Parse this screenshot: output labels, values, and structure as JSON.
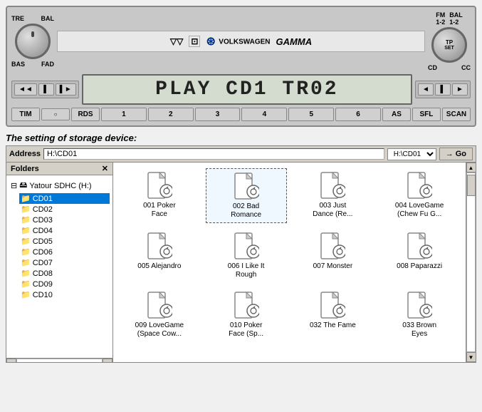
{
  "radio": {
    "knob_left": {
      "top_left": "TRE",
      "top_right": "BAL",
      "bot_left": "BAS",
      "bot_right": "FAD"
    },
    "brand": {
      "logo": "VW",
      "name": "VOLKSWAGEN",
      "model": "GAMMA"
    },
    "transport": {
      "rewind": "◄◄",
      "play_pause": "▌▌",
      "forward": "▌►"
    },
    "display": {
      "text": "PLAY CD1 TR02"
    },
    "fm_badge": "FM\n1-2",
    "bal_badge": "BAL\n1-2",
    "tp_label": "TP",
    "set_label": "SET",
    "cd_label": "CD",
    "cc_label": "CC",
    "nav_left": [
      "◄",
      "▌",
      "►"
    ],
    "nav_right_left": "◄",
    "nav_right_mid": "▌",
    "nav_right_right": "►",
    "presets": {
      "tim": "TIM",
      "dot": "○",
      "rds": "RDS",
      "nums": [
        "1",
        "2",
        "3",
        "4",
        "5",
        "6"
      ],
      "as": "AS",
      "sfl": "SFL",
      "scan": "SCAN"
    }
  },
  "diagram": {
    "label": "The setting of storage device:"
  },
  "browser": {
    "address_label": "Address",
    "address_value": "H:\\CD01",
    "go_label": "Go",
    "folders_label": "Folders",
    "root_item": "Yatour SDHC (H:)",
    "cd_items": [
      "CD01",
      "CD02",
      "CD03",
      "CD04",
      "CD05",
      "CD06",
      "CD07",
      "CD08",
      "CD09",
      "CD10"
    ],
    "selected_folder": "CD01",
    "files": [
      {
        "id": "001",
        "name": "001 Poker\nFace",
        "selected": false
      },
      {
        "id": "002",
        "name": "002 Bad\nRomance",
        "selected": true
      },
      {
        "id": "003",
        "name": "003 Just\nDance (Re...",
        "selected": false
      },
      {
        "id": "004",
        "name": "004 LoveGame\n(Chew Fu G...",
        "selected": false
      },
      {
        "id": "005",
        "name": "005 Alejandro",
        "selected": false
      },
      {
        "id": "006",
        "name": "006 I Like It\nRough",
        "selected": false
      },
      {
        "id": "007",
        "name": "007 Monster",
        "selected": false
      },
      {
        "id": "008",
        "name": "008 Paparazzi",
        "selected": false
      },
      {
        "id": "009",
        "name": "009 LoveGame\n(Space Cow...",
        "selected": false
      },
      {
        "id": "010",
        "name": "010 Poker\nFace (Sp...",
        "selected": false
      },
      {
        "id": "032",
        "name": "032 The Fame",
        "selected": false
      },
      {
        "id": "033",
        "name": "033 Brown\nEyes",
        "selected": false
      }
    ]
  }
}
